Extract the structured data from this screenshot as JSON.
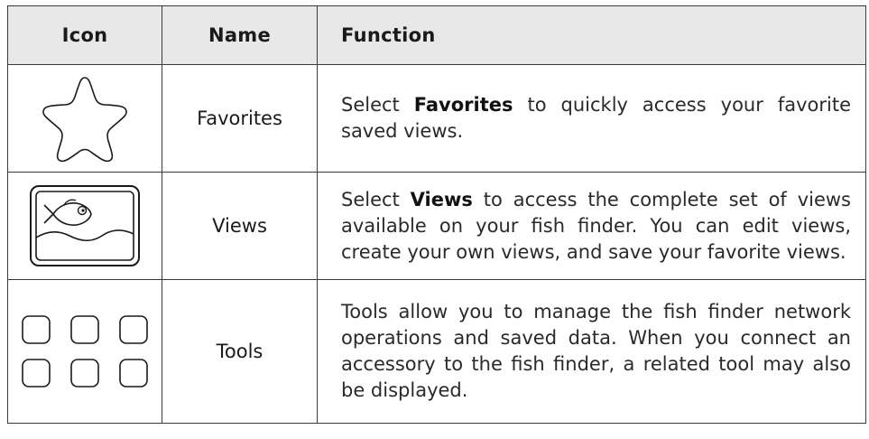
{
  "table": {
    "headers": {
      "icon": "Icon",
      "name": "Name",
      "function": "Function"
    },
    "rows": [
      {
        "icon": "star-icon",
        "name": "Favorites",
        "desc_pre": "Select ",
        "desc_bold": "Favorites",
        "desc_post": " to quickly access your favorite saved views."
      },
      {
        "icon": "fish-picture-icon",
        "name": "Views",
        "desc_pre": "Select ",
        "desc_bold": "Views",
        "desc_post": " to access the complete set of views available on your fish finder. You can edit views, create your own views, and save your favorite views."
      },
      {
        "icon": "tools-grid-icon",
        "name": "Tools",
        "desc": "Tools allow you to manage the fish finder network operations and saved data. When you connect an accessory to the fish finder, a related tool may also be displayed."
      }
    ]
  }
}
